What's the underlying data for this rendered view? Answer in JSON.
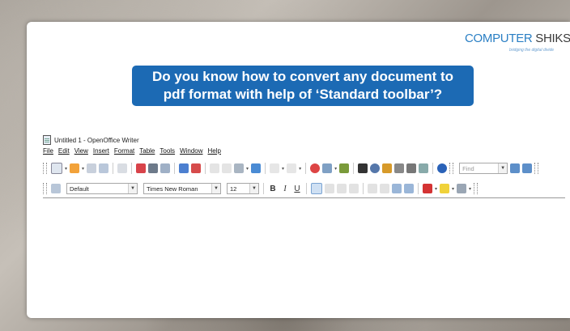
{
  "logo": {
    "part1": "COMPUTER",
    "part2": " SHIKSHA",
    "tagline": "bridging the digital divide"
  },
  "banner": {
    "line1": "Do you know how to convert any document to",
    "line2": "pdf format with help of ‘Standard toolbar’?"
  },
  "window": {
    "title": "Untitled 1 - OpenOffice Writer",
    "menu": [
      "File",
      "Edit",
      "View",
      "Insert",
      "Format",
      "Table",
      "Tools",
      "Window",
      "Help"
    ]
  },
  "formatting_toolbar": {
    "paragraph_style": "Default",
    "font_name": "Times New Roman",
    "font_size": "12",
    "bold": "B",
    "italic": "I",
    "underline": "U"
  },
  "standard_toolbar": {
    "find_placeholder": "Find"
  },
  "colors": {
    "banner": "#1c6ab4",
    "logo_blue": "#2a7fc4"
  }
}
